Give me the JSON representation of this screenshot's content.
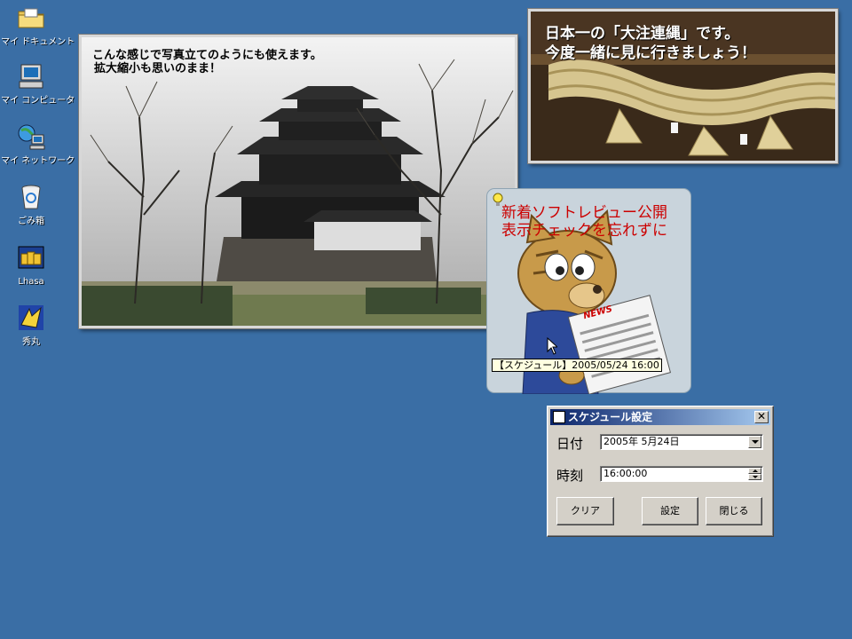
{
  "desktop": {
    "icons": [
      {
        "label": "マイ ドキュメント",
        "icon": "folder-icon"
      },
      {
        "label": "マイ コンピュータ",
        "icon": "computer-icon"
      },
      {
        "label": "マイ ネットワーク",
        "icon": "network-icon"
      },
      {
        "label": "ごみ箱",
        "icon": "recycle-bin-icon"
      },
      {
        "label": "Lhasa",
        "icon": "archive-icon"
      },
      {
        "label": "秀丸",
        "icon": "hidemaru-editor-icon"
      }
    ]
  },
  "castle_photo": {
    "caption_line1": "こんな感じで写真立てのようにも使えます。",
    "caption_line2": "拡大縮小も思いのまま！"
  },
  "rope_photo": {
    "caption_line1": "日本一の「大注連縄」です。",
    "caption_line2": "今度一緒に見に行きましょう！"
  },
  "news_widget": {
    "headline_line1": "新着ソフトレビュー公開",
    "headline_line2": "表示チェックを忘れずに",
    "newspaper_label": "NEWS",
    "tooltip": "【スケジュール】2005/05/24 16:00"
  },
  "schedule_dialog": {
    "title": "スケジュール設定",
    "close_glyph": "✕",
    "date_label": "日付",
    "date_value": "2005年  5月24日",
    "time_label": "時刻",
    "time_value": "16:00:00",
    "clear_label": "クリア",
    "set_label": "設定",
    "close_label": "閉じる"
  },
  "colors": {
    "desktop": "#3a6ea5",
    "titlebar_start": "#0a246a",
    "titlebar_end": "#a6caf0",
    "news_headline": "#cc0000"
  }
}
